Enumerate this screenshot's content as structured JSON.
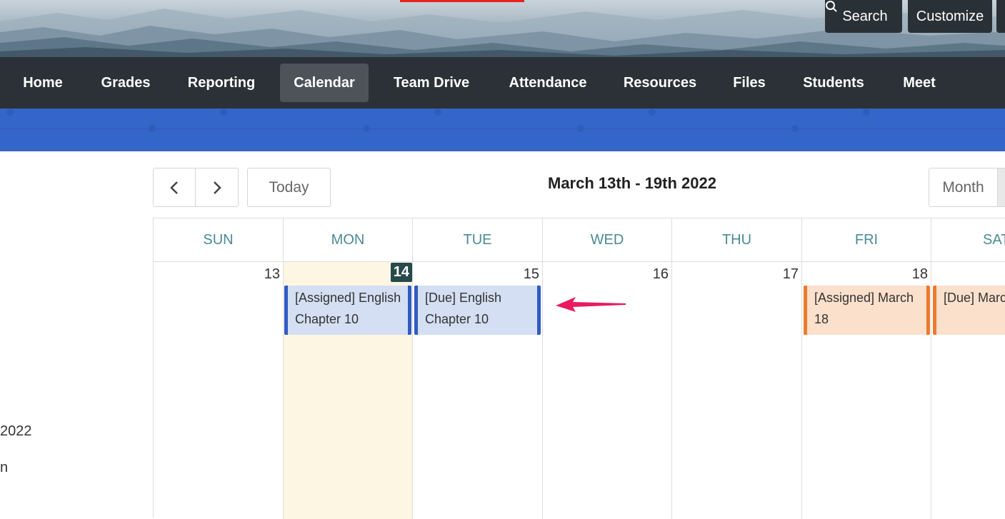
{
  "header": {
    "search_label": "Search",
    "customize_label": "Customize"
  },
  "nav": {
    "items": [
      {
        "label": "Home"
      },
      {
        "label": "Grades"
      },
      {
        "label": "Reporting"
      },
      {
        "label": "Calendar",
        "active": true
      },
      {
        "label": "Team Drive"
      },
      {
        "label": "Attendance"
      },
      {
        "label": "Resources"
      },
      {
        "label": "Files"
      },
      {
        "label": "Students"
      },
      {
        "label": "Meet"
      }
    ]
  },
  "sidebar": {
    "fragment_1": "2022",
    "fragment_2": "n"
  },
  "toolbar": {
    "prev_icon": "chevron-left-icon",
    "next_icon": "chevron-right-icon",
    "today_label": "Today",
    "title": "March 13th - 19th 2022",
    "month_label": "Month"
  },
  "calendar": {
    "days": [
      {
        "name": "SUN",
        "date": "13"
      },
      {
        "name": "MON",
        "date": "14",
        "today": true
      },
      {
        "name": "TUE",
        "date": "15"
      },
      {
        "name": "WED",
        "date": "16"
      },
      {
        "name": "THU",
        "date": "17"
      },
      {
        "name": "FRI",
        "date": "18"
      },
      {
        "name": "SAT",
        "date": ""
      }
    ],
    "events": [
      {
        "day": "MON",
        "text": "[Assigned] English Chapter 10",
        "color": "blue"
      },
      {
        "day": "TUE",
        "text": "[Due] English Chapter 10",
        "color": "blue"
      },
      {
        "day": "FRI",
        "text": "[Assigned] March 18",
        "color": "orange"
      },
      {
        "day": "SAT",
        "text": "[Due] March",
        "color": "orange"
      }
    ]
  },
  "colors": {
    "nav_bg": "#2b3136",
    "blue_band": "#3466c9",
    "header_accent": "#e5231e",
    "day_header_text": "#4b8a95",
    "today_bg": "#fdf6e3",
    "event_blue": "#2f5cc4",
    "event_orange": "#ec7a2c",
    "annotation_arrow": "#ea1a5f"
  }
}
